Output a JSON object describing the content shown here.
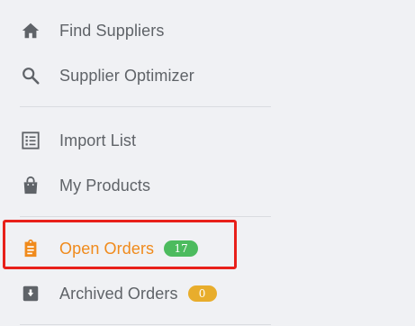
{
  "sidebar": {
    "items": [
      {
        "label": "Find Suppliers",
        "icon": "home-icon"
      },
      {
        "label": "Supplier Optimizer",
        "icon": "search-icon"
      },
      {
        "label": "Import List",
        "icon": "list-icon"
      },
      {
        "label": "My Products",
        "icon": "shopping-bag-icon"
      },
      {
        "label": "Open Orders",
        "icon": "clipboard-icon",
        "badge": "17",
        "active": true
      },
      {
        "label": "Archived Orders",
        "icon": "archive-box-icon",
        "badge": "0"
      }
    ]
  },
  "colors": {
    "text": "#5f6368",
    "active": "#f08a1b",
    "badge_open": "#4cbb5e",
    "badge_archived": "#e8ad2c",
    "highlight": "#e8201a",
    "background": "#f0f1f4"
  }
}
